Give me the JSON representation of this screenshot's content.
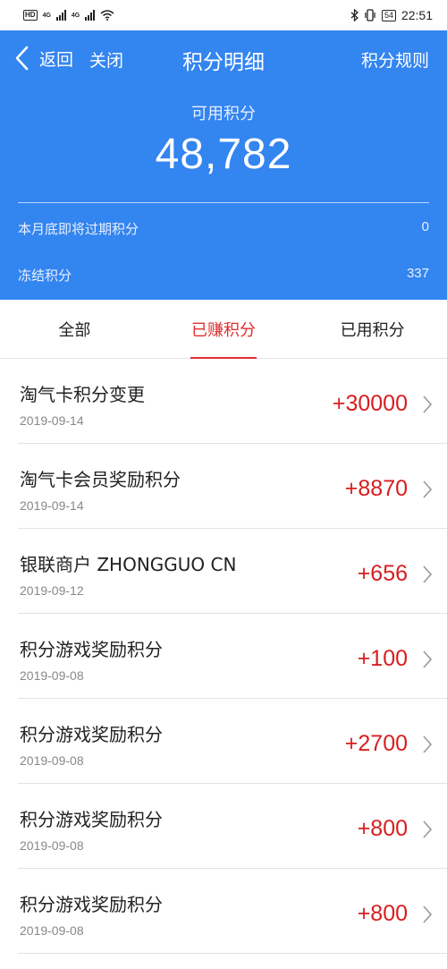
{
  "status_bar": {
    "network_badge": "HD",
    "signal1": "4G",
    "signal2": "4G",
    "battery": "54",
    "time": "22:51"
  },
  "nav": {
    "back_label": "返回",
    "close_label": "关闭",
    "title": "积分明细",
    "rules_label": "积分规则"
  },
  "summary": {
    "available_label": "可用积分",
    "available_value": "48,782",
    "expiring_label": "本月底即将过期积分",
    "expiring_value": "0",
    "frozen_label": "冻结积分",
    "frozen_value": "337"
  },
  "tabs": [
    {
      "label": "全部",
      "active": false
    },
    {
      "label": "已赚积分",
      "active": true
    },
    {
      "label": "已用积分",
      "active": false
    }
  ],
  "records": [
    {
      "name": "淘气卡积分变更",
      "date": "2019-09-14",
      "amount": "+30000"
    },
    {
      "name": "淘气卡会员奖励积分",
      "date": "2019-09-14",
      "amount": "+8870"
    },
    {
      "name": "银联商户 ZHONGGUO CN",
      "date": "2019-09-12",
      "amount": "+656"
    },
    {
      "name": "积分游戏奖励积分",
      "date": "2019-09-08",
      "amount": "+100"
    },
    {
      "name": "积分游戏奖励积分",
      "date": "2019-09-08",
      "amount": "+2700"
    },
    {
      "name": "积分游戏奖励积分",
      "date": "2019-09-08",
      "amount": "+800"
    },
    {
      "name": "积分游戏奖励积分",
      "date": "2019-09-08",
      "amount": "+800"
    }
  ],
  "colors": {
    "header_bg": "#3385f0",
    "active_tab": "#e02e2e",
    "amount": "#d81e1e"
  },
  "icons": {
    "back": "chevron-left-icon",
    "row_arrow": "chevron-right-icon",
    "bluetooth": "bluetooth-icon",
    "vibrate": "vibrate-icon",
    "wifi": "wifi-icon"
  }
}
